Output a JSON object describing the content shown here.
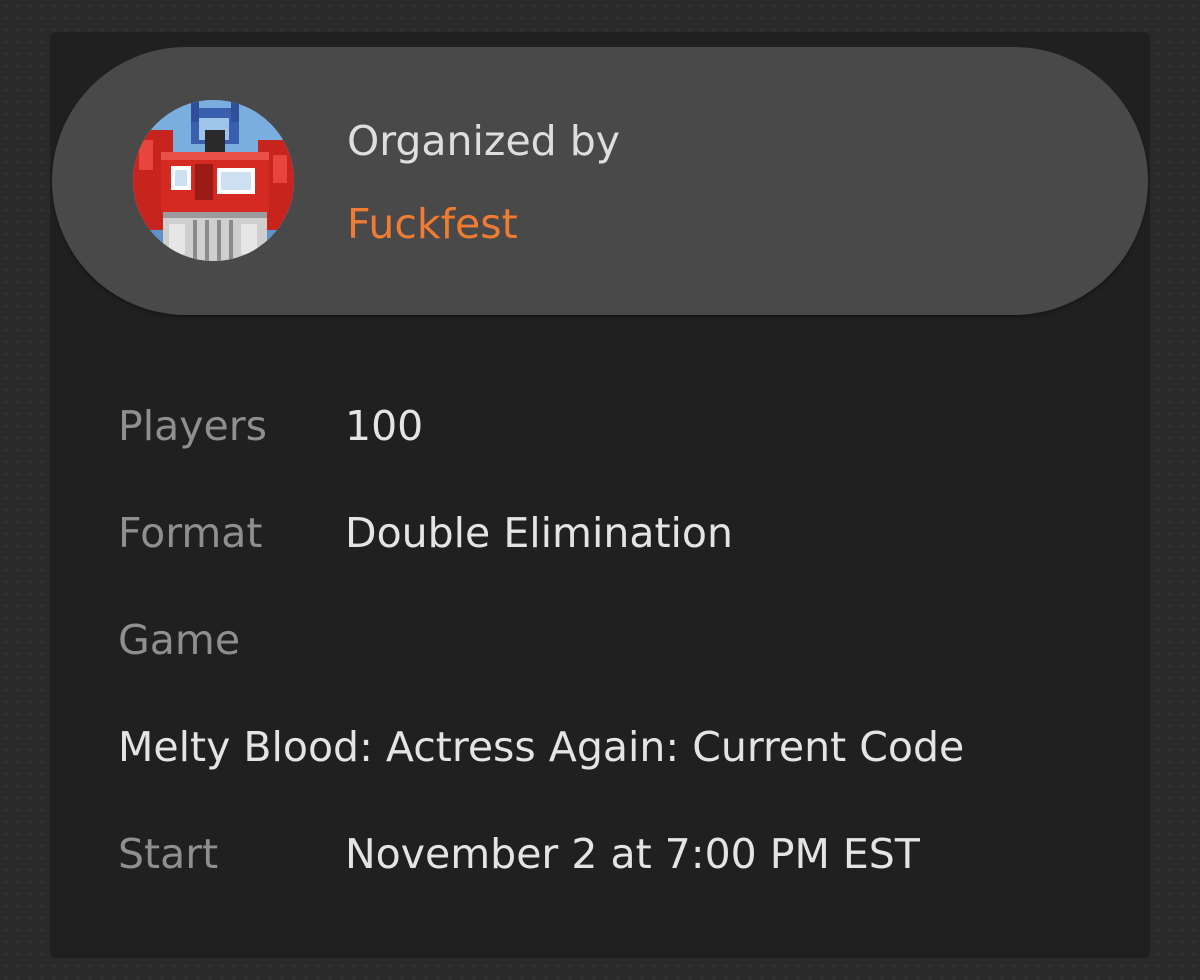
{
  "organizer": {
    "label": "Organized by",
    "name": "Fuckfest",
    "avatar_icon": "robot-avatar",
    "name_color": "#f07b33"
  },
  "details": {
    "players_label": "Players",
    "players_value": "100",
    "format_label": "Format",
    "format_value": "Double Elimination",
    "game_label": "Game",
    "game_value": "Melty Blood: Actress Again: Current Code",
    "start_label": "Start",
    "start_value": "November 2 at 7:00 PM EST"
  }
}
